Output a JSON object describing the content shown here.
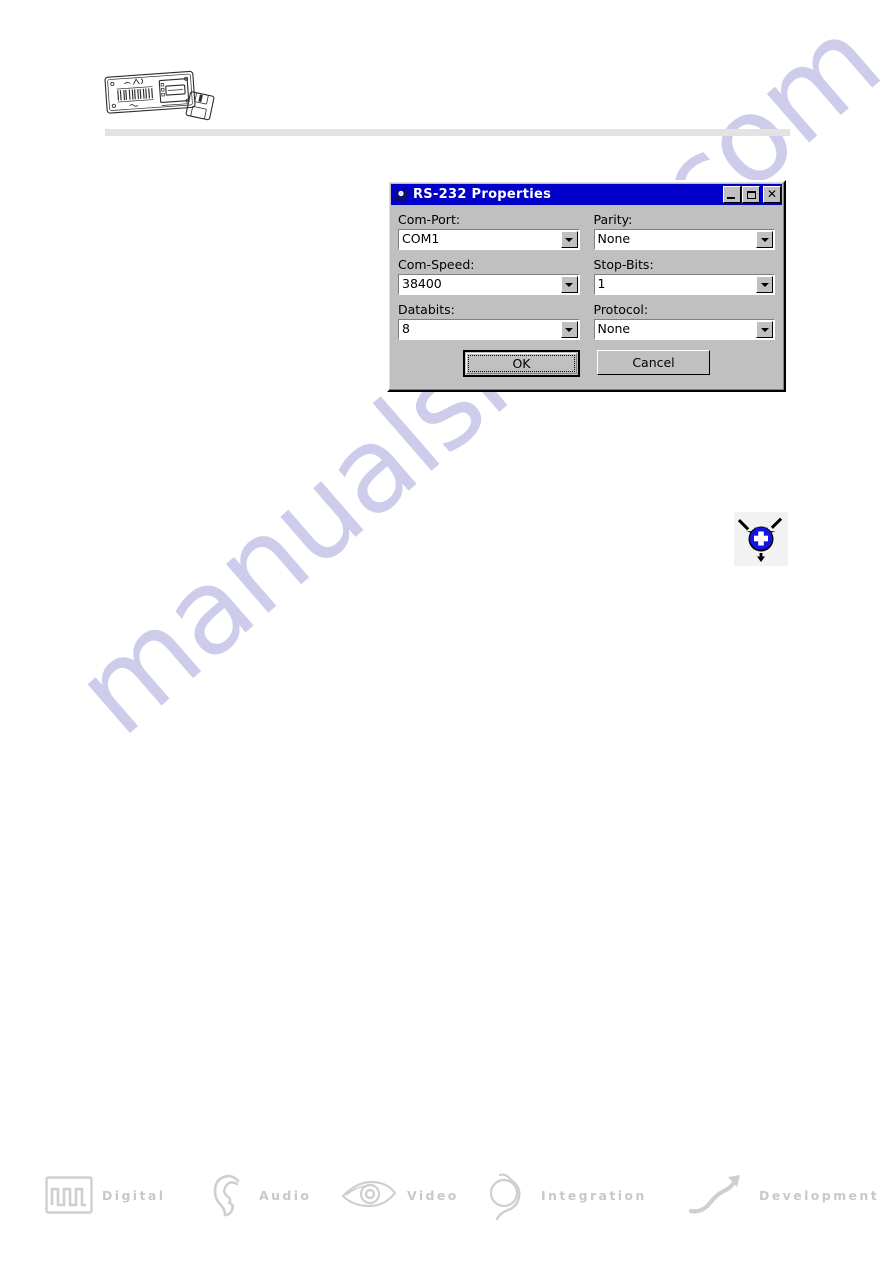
{
  "page": {
    "watermark_text": "manualshive.com"
  },
  "header": {
    "device_art_name": "barcode-terminal-with-floppy-disk-illustration"
  },
  "dialog": {
    "title": "RS-232 Properties",
    "title_icon": "device-icon",
    "window_buttons": {
      "minimize": "_",
      "maximize": "□",
      "close": "✕"
    },
    "fields": [
      {
        "label": "Com-Port:",
        "value": "COM1",
        "name": "com-port"
      },
      {
        "label": "Parity:",
        "value": "None",
        "name": "parity"
      },
      {
        "label": "Com-Speed:",
        "value": "38400",
        "name": "com-speed"
      },
      {
        "label": "Stop-Bits:",
        "value": "1",
        "name": "stop-bits"
      },
      {
        "label": "Databits:",
        "value": "8",
        "name": "databits"
      },
      {
        "label": "Protocol:",
        "value": "None",
        "name": "protocol"
      }
    ],
    "buttons": {
      "ok": "OK",
      "cancel": "Cancel"
    },
    "colors": {
      "titlebar": "#0000c8",
      "face": "#c0c0c0",
      "field": "#ffffff"
    }
  },
  "converge_icon": {
    "name": "blue-plus-converge-icon",
    "circle_color": "#1414e6",
    "symbol": "+"
  },
  "footer": {
    "items": [
      {
        "label": "Digital",
        "icon": "square-wave-icon"
      },
      {
        "label": "Audio",
        "icon": "ear-icon"
      },
      {
        "label": "Video",
        "icon": "eye-icon"
      },
      {
        "label": "Integration",
        "icon": "interlocking-loops-icon"
      },
      {
        "label": "Development",
        "icon": "rising-arrow-icon"
      }
    ],
    "color": "#c9c9c9"
  }
}
